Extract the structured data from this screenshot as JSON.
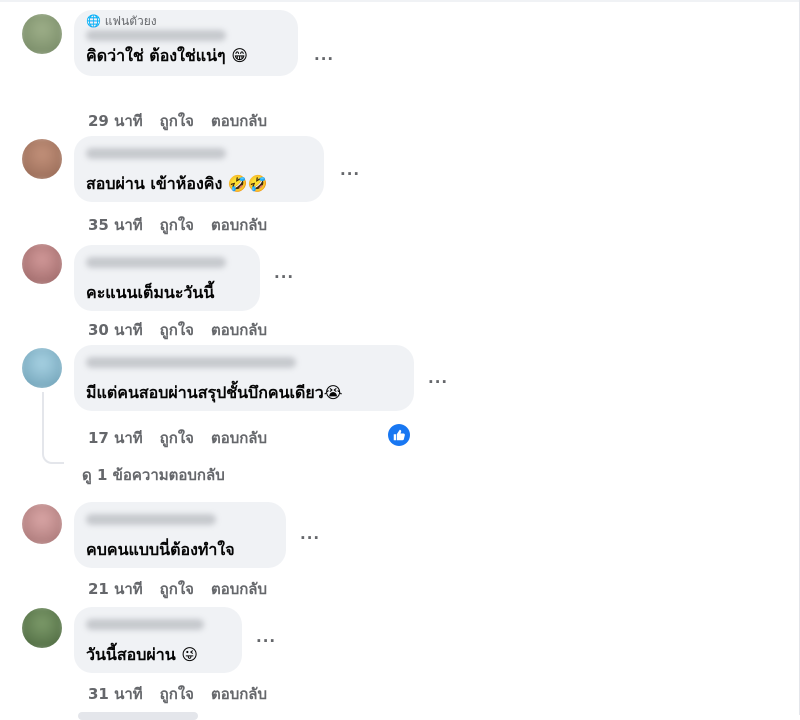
{
  "comments": [
    {
      "badge": "🌐 แฟนตัวยง",
      "text": "คิดว่าใช่ ต้องใช่แน่ๆ",
      "emoji": "😁",
      "time": "29 นาที",
      "like": "ถูกใจ",
      "reply": "ตอบกลับ",
      "avatar_color": "#7a8f6a"
    },
    {
      "text": "สอบผ่าน เข้าห้องคิง",
      "emoji": "🤣🤣",
      "time": "35 นาที",
      "like": "ถูกใจ",
      "reply": "ตอบกลับ",
      "avatar_color": "#9b6f5a"
    },
    {
      "text": "คะแนนเต็มนะวันนี้",
      "emoji": "",
      "time": "30 นาที",
      "like": "ถูกใจ",
      "reply": "ตอบกลับ",
      "avatar_color": "#a06b6b"
    },
    {
      "text": "มีแต่คนสอบผ่านสรุปชั้นบึกคนเดียว",
      "emoji": "😭",
      "time": "17 นาที",
      "like": "ถูกใจ",
      "reply": "ตอบกลับ",
      "avatar_color": "#7fb3c9",
      "reaction": "like"
    },
    {
      "text": "คบคนแบบนี่ต้องทำใจ",
      "emoji": "",
      "time": "21 นาที",
      "like": "ถูกใจ",
      "reply": "ตอบกลับ",
      "avatar_color": "#b07a7a"
    },
    {
      "text": "วันนี้สอบผ่าน",
      "emoji": "😜",
      "time": "31 นาที",
      "like": "ถูกใจ",
      "reply": "ตอบกลับ",
      "avatar_color": "#5d7a4c"
    }
  ],
  "view_replies": "ดู 1 ข้อความตอบกลับ",
  "more_glyph": "···",
  "colors": {
    "bubble": "#f0f2f5",
    "meta": "#65676b",
    "like_blue": "#1877f2"
  }
}
